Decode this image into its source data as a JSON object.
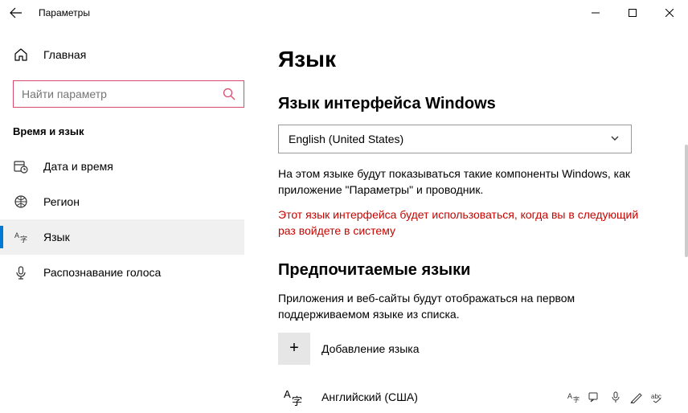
{
  "titlebar": {
    "title": "Параметры"
  },
  "sidebar": {
    "home": "Главная",
    "search_placeholder": "Найти параметр",
    "section": "Время и язык",
    "items": [
      {
        "label": "Дата и время"
      },
      {
        "label": "Регион"
      },
      {
        "label": "Язык"
      },
      {
        "label": "Распознавание голоса"
      }
    ]
  },
  "main": {
    "heading": "Язык",
    "display_lang_title": "Язык интерфейса Windows",
    "display_lang_value": "English (United States)",
    "display_desc": "На этом языке будут показываться такие компоненты Windows, как приложение \"Параметры\" и проводник.",
    "display_warn": "Этот язык интерфейса будет использоваться, когда вы в следующий раз войдете в систему",
    "preferred_title": "Предпочитаемые языки",
    "preferred_desc": "Приложения и веб-сайты будут отображаться на первом поддерживаемом языке из списка.",
    "add_label": "Добавление языка",
    "languages": [
      {
        "label": "Английский (США)"
      }
    ]
  }
}
